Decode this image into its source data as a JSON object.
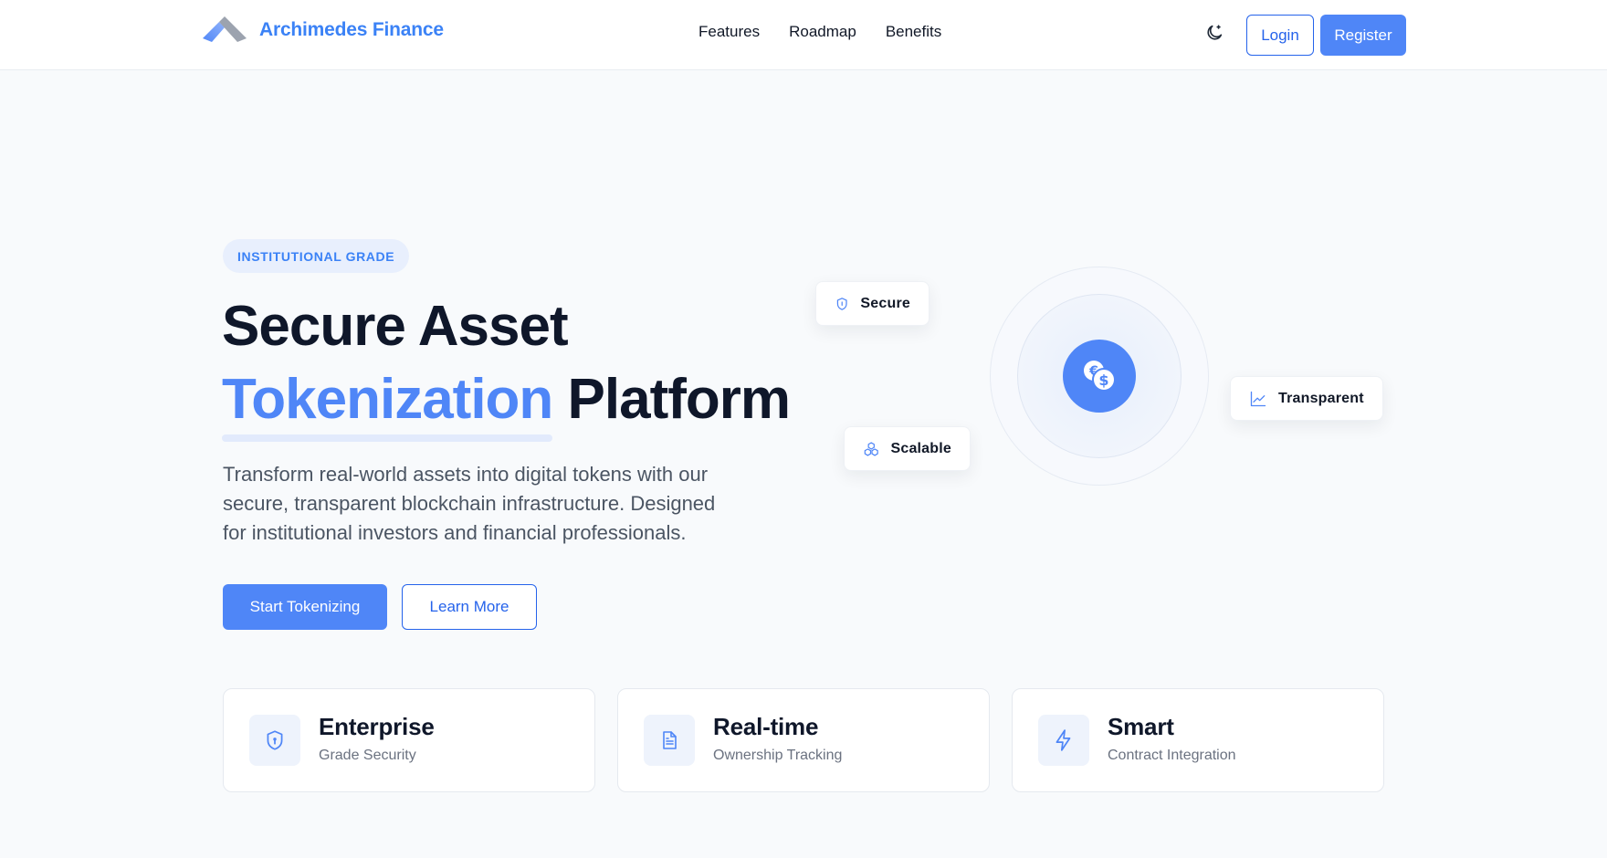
{
  "nav": {
    "brand": "Archimedes Finance",
    "links": [
      "Features",
      "Roadmap",
      "Benefits"
    ],
    "theme_icon": "moon-icon",
    "login_label": "Login",
    "register_label": "Register"
  },
  "hero": {
    "badge": "INSTITUTIONAL GRADE",
    "title_line1": "Secure Asset",
    "title_highlight": "Tokenization",
    "title_rest": "Platform",
    "description": "Transform real-world assets into digital tokens with our secure, transparent blockchain infrastructure. Designed for institutional investors and financial professionals.",
    "primary_cta": "Start Tokenizing",
    "secondary_cta": "Learn More"
  },
  "visual": {
    "center_icon": "coins-icon",
    "chips": [
      {
        "label": "Secure",
        "icon": "shield-icon"
      },
      {
        "label": "Scalable",
        "icon": "boxes-icon"
      },
      {
        "label": "Transparent",
        "icon": "line-chart-icon"
      }
    ]
  },
  "features": [
    {
      "title": "Enterprise",
      "subtitle": "Grade Security",
      "icon": "shield-lock-icon"
    },
    {
      "title": "Real-time",
      "subtitle": "Ownership Tracking",
      "icon": "document-icon"
    },
    {
      "title": "Smart",
      "subtitle": "Contract Integration",
      "icon": "lightning-icon"
    }
  ],
  "colors": {
    "accent": "#4f86f7",
    "accent_dark": "#2563eb",
    "text": "#0f172a",
    "muted": "#6b7280",
    "background": "#f8fafc"
  }
}
